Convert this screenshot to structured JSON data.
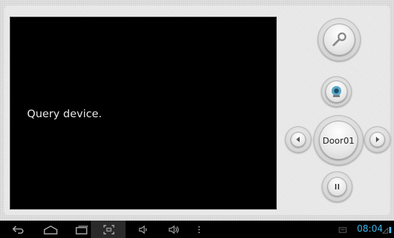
{
  "video": {
    "status_text": "Query device."
  },
  "controls": {
    "door_label": "Door01"
  },
  "statusbar": {
    "time": "08:04"
  },
  "icons": {
    "unlock": "key-icon",
    "camera": "camera-icon",
    "prev": "arrow-left-icon",
    "next": "arrow-right-icon",
    "pause": "pause-icon",
    "back": "back-icon",
    "home": "home-icon",
    "recent": "recent-apps-icon",
    "screenshot": "screenshot-icon",
    "vol_down": "volume-down-icon",
    "vol_up": "volume-up-icon",
    "menu": "menu-icon"
  },
  "colors": {
    "clock": "#3fb4e6",
    "video_bg": "#000000"
  }
}
